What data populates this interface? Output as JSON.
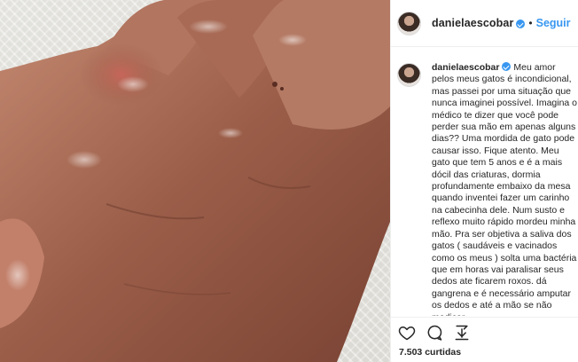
{
  "post": {
    "image_alt": "Photo of a swollen hand after a cat bite",
    "header": {
      "username": "danielaescobar",
      "separator": "•",
      "follow_label": "Seguir"
    },
    "caption": {
      "username": "danielaescobar",
      "text": "Meu amor pelos meus gatos é incondicional, mas passei por uma situação que nunca imaginei possível. Imagina o médico te dizer que você pode perder sua mão em apenas alguns dias?? Uma mordida de gato pode causar isso. Fique atento. Meu gato que tem 5 anos e é a mais dócil das criaturas, dormia profundamente embaixo da mesa quando inventei fazer um carinho na cabecinha dele. Num susto e reflexo muito rápido mordeu minha mão. Pra ser objetiva a saliva dos gatos ( saudáveis e vacinados como os meus ) solta uma bactéria que em horas vai paralisar seus dedos ate ficarem roxos. dá gangrena e é necessário amputar os dedos e até a mão se não medicar"
    },
    "actions": {
      "like_icon": "heart-icon",
      "comment_icon": "comment-icon",
      "share_icon": "share-icon"
    },
    "likes_text": "7.503 curtidas"
  }
}
